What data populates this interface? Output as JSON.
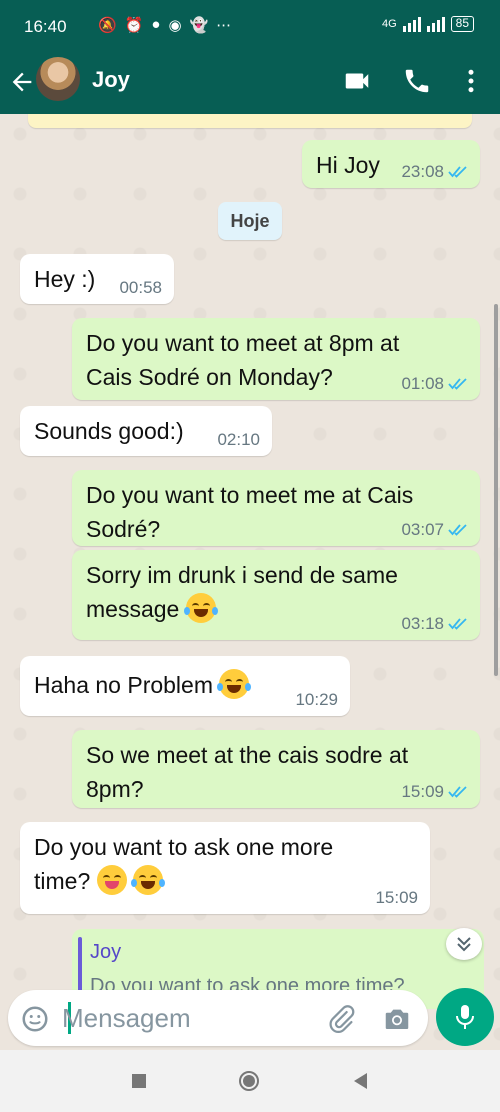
{
  "status_bar": {
    "time": "16:40",
    "network": "4G",
    "battery": "85"
  },
  "header": {
    "contact_name": "Joy"
  },
  "date_chip": "Hoje",
  "messages": [
    {
      "direction": "out",
      "lines": [
        "Hi Joy"
      ],
      "time": "23:08"
    },
    {
      "direction": "in",
      "lines": [
        "Hey :)"
      ],
      "time": "00:58"
    },
    {
      "direction": "out",
      "lines": [
        "Do you want to meet at 8pm at",
        "Cais Sodré on Monday?"
      ],
      "time": "01:08"
    },
    {
      "direction": "in",
      "lines": [
        "Sounds good:)"
      ],
      "time": "02:10"
    },
    {
      "direction": "out",
      "lines": [
        "Do you want to meet me at Cais",
        "Sodré?"
      ],
      "time": "03:07"
    },
    {
      "direction": "out",
      "lines": [
        "Sorry im drunk i send de same",
        "message"
      ],
      "time": "03:18"
    },
    {
      "direction": "in",
      "lines": [
        "Haha no Problem"
      ],
      "time": "10:29"
    },
    {
      "direction": "out",
      "lines": [
        "So we meet at the cais sodre at",
        "8pm?"
      ],
      "time": "15:09"
    },
    {
      "direction": "in",
      "lines": [
        "Do you want to ask one more",
        "time?"
      ],
      "time": "15:09"
    }
  ],
  "reply_preview": {
    "author": "Joy",
    "quoted_text": "Do you want to ask one more time?"
  },
  "composer": {
    "placeholder": "Mensagem"
  },
  "colors": {
    "header": "#075e54",
    "outgoing_bubble": "#dcf8c6",
    "incoming_bubble": "#ffffff",
    "accent": "#00a884",
    "read_ticks": "#34b7f1"
  }
}
